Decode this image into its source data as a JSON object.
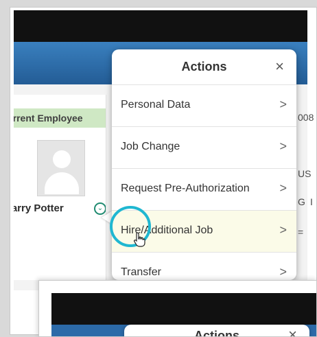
{
  "employee": {
    "badge": "Current Employee",
    "name": "Harry Potter",
    "expand_icon": "chevron-down-circle-icon"
  },
  "right_fragments": [
    "008",
    "US",
    "G",
    "I",
    "="
  ],
  "actions": {
    "title": "Actions",
    "close_symbol": "×",
    "items": [
      {
        "label": "Personal Data",
        "arrow": ">"
      },
      {
        "label": "Job Change",
        "arrow": ">"
      },
      {
        "label": "Request Pre-Authorization",
        "arrow": ">"
      },
      {
        "label": "Hire/Additional Job",
        "arrow": ">"
      },
      {
        "label": "Transfer",
        "arrow": ">"
      }
    ]
  },
  "second_window": {
    "title": "Actions",
    "close_symbol": "×"
  },
  "colors": {
    "topbar": "#111111",
    "blue_header": "#2c6aa8",
    "badge_green": "#cfe8c4",
    "highlight": "#fbfbe8",
    "cursor_ring": "#1fb7d1"
  }
}
